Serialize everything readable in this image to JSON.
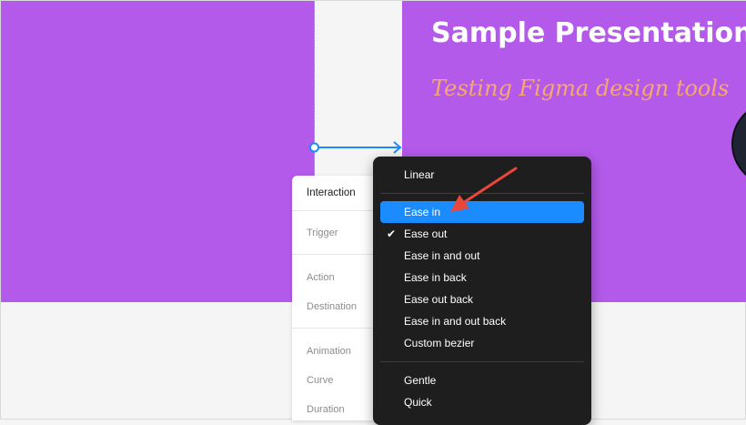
{
  "slide": {
    "title": "Sample Presentation",
    "subtitle": "Testing Figma design tools"
  },
  "interaction_panel": {
    "header": "Interaction",
    "trigger_label": "Trigger",
    "action_label": "Action",
    "destination_label": "Destination",
    "animation_label": "Animation",
    "curve_label": "Curve",
    "duration_label": "Duration"
  },
  "easing_menu": {
    "items": [
      {
        "label": "Linear",
        "checked": false,
        "highlighted": false
      },
      {
        "label": "Ease in",
        "checked": false,
        "highlighted": true
      },
      {
        "label": "Ease out",
        "checked": true,
        "highlighted": false
      },
      {
        "label": "Ease in and out",
        "checked": false,
        "highlighted": false
      },
      {
        "label": "Ease in back",
        "checked": false,
        "highlighted": false
      },
      {
        "label": "Ease out back",
        "checked": false,
        "highlighted": false
      },
      {
        "label": "Ease in and out back",
        "checked": false,
        "highlighted": false
      },
      {
        "label": "Custom bezier",
        "checked": false,
        "highlighted": false
      },
      {
        "label": "Gentle",
        "checked": false,
        "highlighted": false
      },
      {
        "label": "Quick",
        "checked": false,
        "highlighted": false
      }
    ],
    "check_glyph": "✔"
  },
  "colors": {
    "frame": "#b45aeb",
    "subtitle": "#f7a86b",
    "menu_bg": "#1e1e1e",
    "highlight": "#1a8cff",
    "connector": "#1a8cff",
    "annotation_arrow": "#e8473a"
  },
  "icons": {
    "connector": "prototype-connection-arrow",
    "annotation": "red-callout-arrow"
  }
}
